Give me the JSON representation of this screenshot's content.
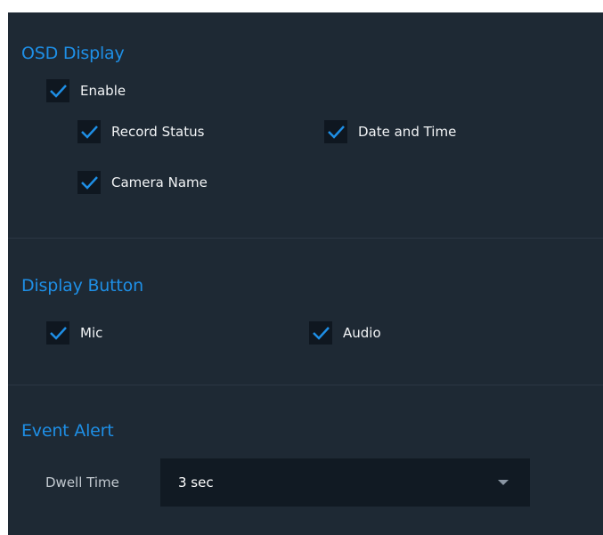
{
  "colors": {
    "panel_bg": "#1e2934",
    "accent": "#1e8fe6",
    "checkbox_bg": "#0f1720",
    "check_mark": "#1e8fe6"
  },
  "osd_display": {
    "title": "OSD Display",
    "enable": {
      "label": "Enable",
      "checked": true
    },
    "record_status": {
      "label": "Record Status",
      "checked": true
    },
    "date_and_time": {
      "label": "Date and Time",
      "checked": true
    },
    "camera_name": {
      "label": "Camera Name",
      "checked": true
    }
  },
  "display_button": {
    "title": "Display Button",
    "mic": {
      "label": "Mic",
      "checked": true
    },
    "audio": {
      "label": "Audio",
      "checked": true
    }
  },
  "event_alert": {
    "title": "Event Alert",
    "dwell_time": {
      "label": "Dwell Time",
      "value": "3 sec",
      "icon": "chevron-down-icon"
    }
  }
}
